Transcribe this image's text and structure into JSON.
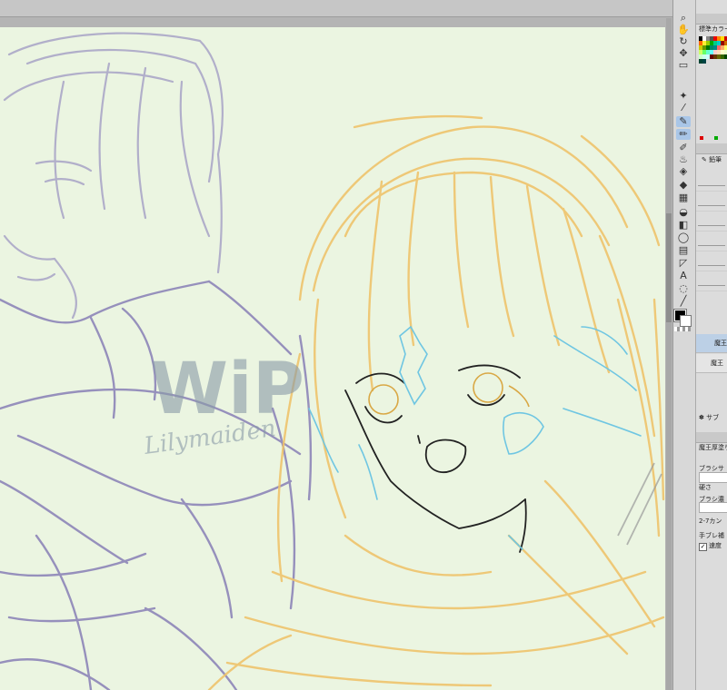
{
  "canvas": {
    "watermark_main": "WiP",
    "watermark_sub": "Lilymaiden"
  },
  "tools": [
    "search-icon",
    "hand-icon",
    "rotate-icon",
    "move-icon",
    "select-rect-icon",
    "magic-wand-icon",
    "eyedropper-icon",
    "pen-icon",
    "pencil-icon",
    "brush-icon",
    "airbrush-icon",
    "eraser-icon",
    "blend-icon",
    "fill-icon",
    "gradient-icon",
    "figure-icon",
    "frame-icon",
    "ruler-icon",
    "text-icon",
    "balloon-icon",
    "line-correct-icon"
  ],
  "color_panel": {
    "title": "標準カラーセット",
    "main_color": "#000000",
    "sub_color": "#ffffff"
  },
  "subtool_panel": {
    "active_tool": "鉛筆"
  },
  "layer_panel": {
    "layers": [
      "魔王",
      "魔王"
    ],
    "bottom_label": "サブ"
  },
  "tool_property": {
    "title": "魔王厚塗り",
    "brush_size_label": "ブラシサ",
    "density_label": "硬さ",
    "brush_density_label": "ブラシ濃",
    "texture_label": "2-7カン",
    "stabilization_label": "手ブレ補",
    "speed_label": "速度",
    "speed_checked": "✓"
  }
}
